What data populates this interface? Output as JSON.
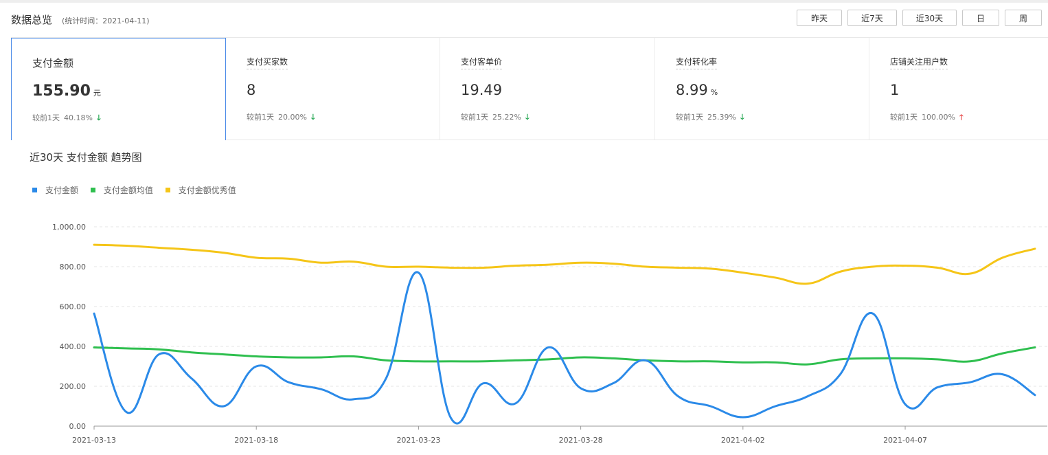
{
  "header": {
    "title": "数据总览",
    "stat_time": "(统计时间：2021-04-11)",
    "periods": [
      {
        "label": "昨天",
        "active": true
      },
      {
        "label": "近7天",
        "active": false
      },
      {
        "label": "近30天",
        "active": false
      },
      {
        "label": "日",
        "active": false
      },
      {
        "label": "周",
        "active": false
      }
    ]
  },
  "cards": [
    {
      "label": "支付金额",
      "value": "155.90",
      "unit": "元",
      "compare": "较前1天",
      "pct": "40.18%",
      "trend": "down",
      "active": true
    },
    {
      "label": "支付买家数",
      "value": "8",
      "unit": "",
      "compare": "较前1天",
      "pct": "20.00%",
      "trend": "down",
      "active": false
    },
    {
      "label": "支付客单价",
      "value": "19.49",
      "unit": "",
      "compare": "较前1天",
      "pct": "25.22%",
      "trend": "down",
      "active": false
    },
    {
      "label": "支付转化率",
      "value": "8.99",
      "unit": "%",
      "compare": "较前1天",
      "pct": "25.39%",
      "trend": "down",
      "active": false
    },
    {
      "label": "店铺关注用户数",
      "value": "1",
      "unit": "",
      "compare": "较前1天",
      "pct": "100.00%",
      "trend": "up",
      "active": false
    }
  ],
  "chart_title": "近30天 支付金额 趋势图",
  "colors": {
    "blue": "#2b8ae8",
    "green": "#2fbf4f",
    "yellow": "#f5c518",
    "accent": "#3a78d8"
  },
  "chart_data": {
    "type": "line",
    "x": [
      "2021-03-13",
      "2021-03-14",
      "2021-03-15",
      "2021-03-16",
      "2021-03-17",
      "2021-03-18",
      "2021-03-19",
      "2021-03-20",
      "2021-03-21",
      "2021-03-22",
      "2021-03-23",
      "2021-03-24",
      "2021-03-25",
      "2021-03-26",
      "2021-03-27",
      "2021-03-28",
      "2021-03-29",
      "2021-03-30",
      "2021-03-31",
      "2021-04-01",
      "2021-04-02",
      "2021-04-03",
      "2021-04-04",
      "2021-04-05",
      "2021-04-06",
      "2021-04-07",
      "2021-04-08",
      "2021-04-09",
      "2021-04-10",
      "2021-04-11"
    ],
    "x_ticks": [
      "2021-03-13",
      "2021-03-18",
      "2021-03-23",
      "2021-03-28",
      "2021-04-02",
      "2021-04-07"
    ],
    "y_ticks": [
      "0.00",
      "200.00",
      "400.00",
      "600.00",
      "800.00",
      "1,000.00"
    ],
    "ylim": [
      0,
      1000
    ],
    "grid": true,
    "legend_position": "top-left",
    "series": [
      {
        "name": "支付金额",
        "color": "#2b8ae8",
        "values": [
          565,
          70,
          360,
          240,
          100,
          300,
          220,
          185,
          135,
          240,
          770,
          40,
          215,
          115,
          395,
          190,
          215,
          330,
          150,
          100,
          45,
          100,
          150,
          260,
          565,
          110,
          195,
          220,
          260,
          156
        ]
      },
      {
        "name": "支付金额均值",
        "color": "#2fbf4f",
        "values": [
          395,
          390,
          385,
          370,
          360,
          350,
          345,
          345,
          350,
          330,
          325,
          325,
          325,
          330,
          335,
          345,
          340,
          330,
          325,
          325,
          320,
          320,
          310,
          335,
          340,
          340,
          335,
          325,
          365,
          395
        ]
      },
      {
        "name": "支付金额优秀值",
        "color": "#f5c518",
        "values": [
          910,
          905,
          895,
          885,
          870,
          845,
          840,
          820,
          825,
          800,
          800,
          795,
          795,
          805,
          810,
          820,
          815,
          800,
          795,
          790,
          770,
          745,
          715,
          775,
          800,
          805,
          795,
          765,
          845,
          890
        ]
      }
    ]
  }
}
